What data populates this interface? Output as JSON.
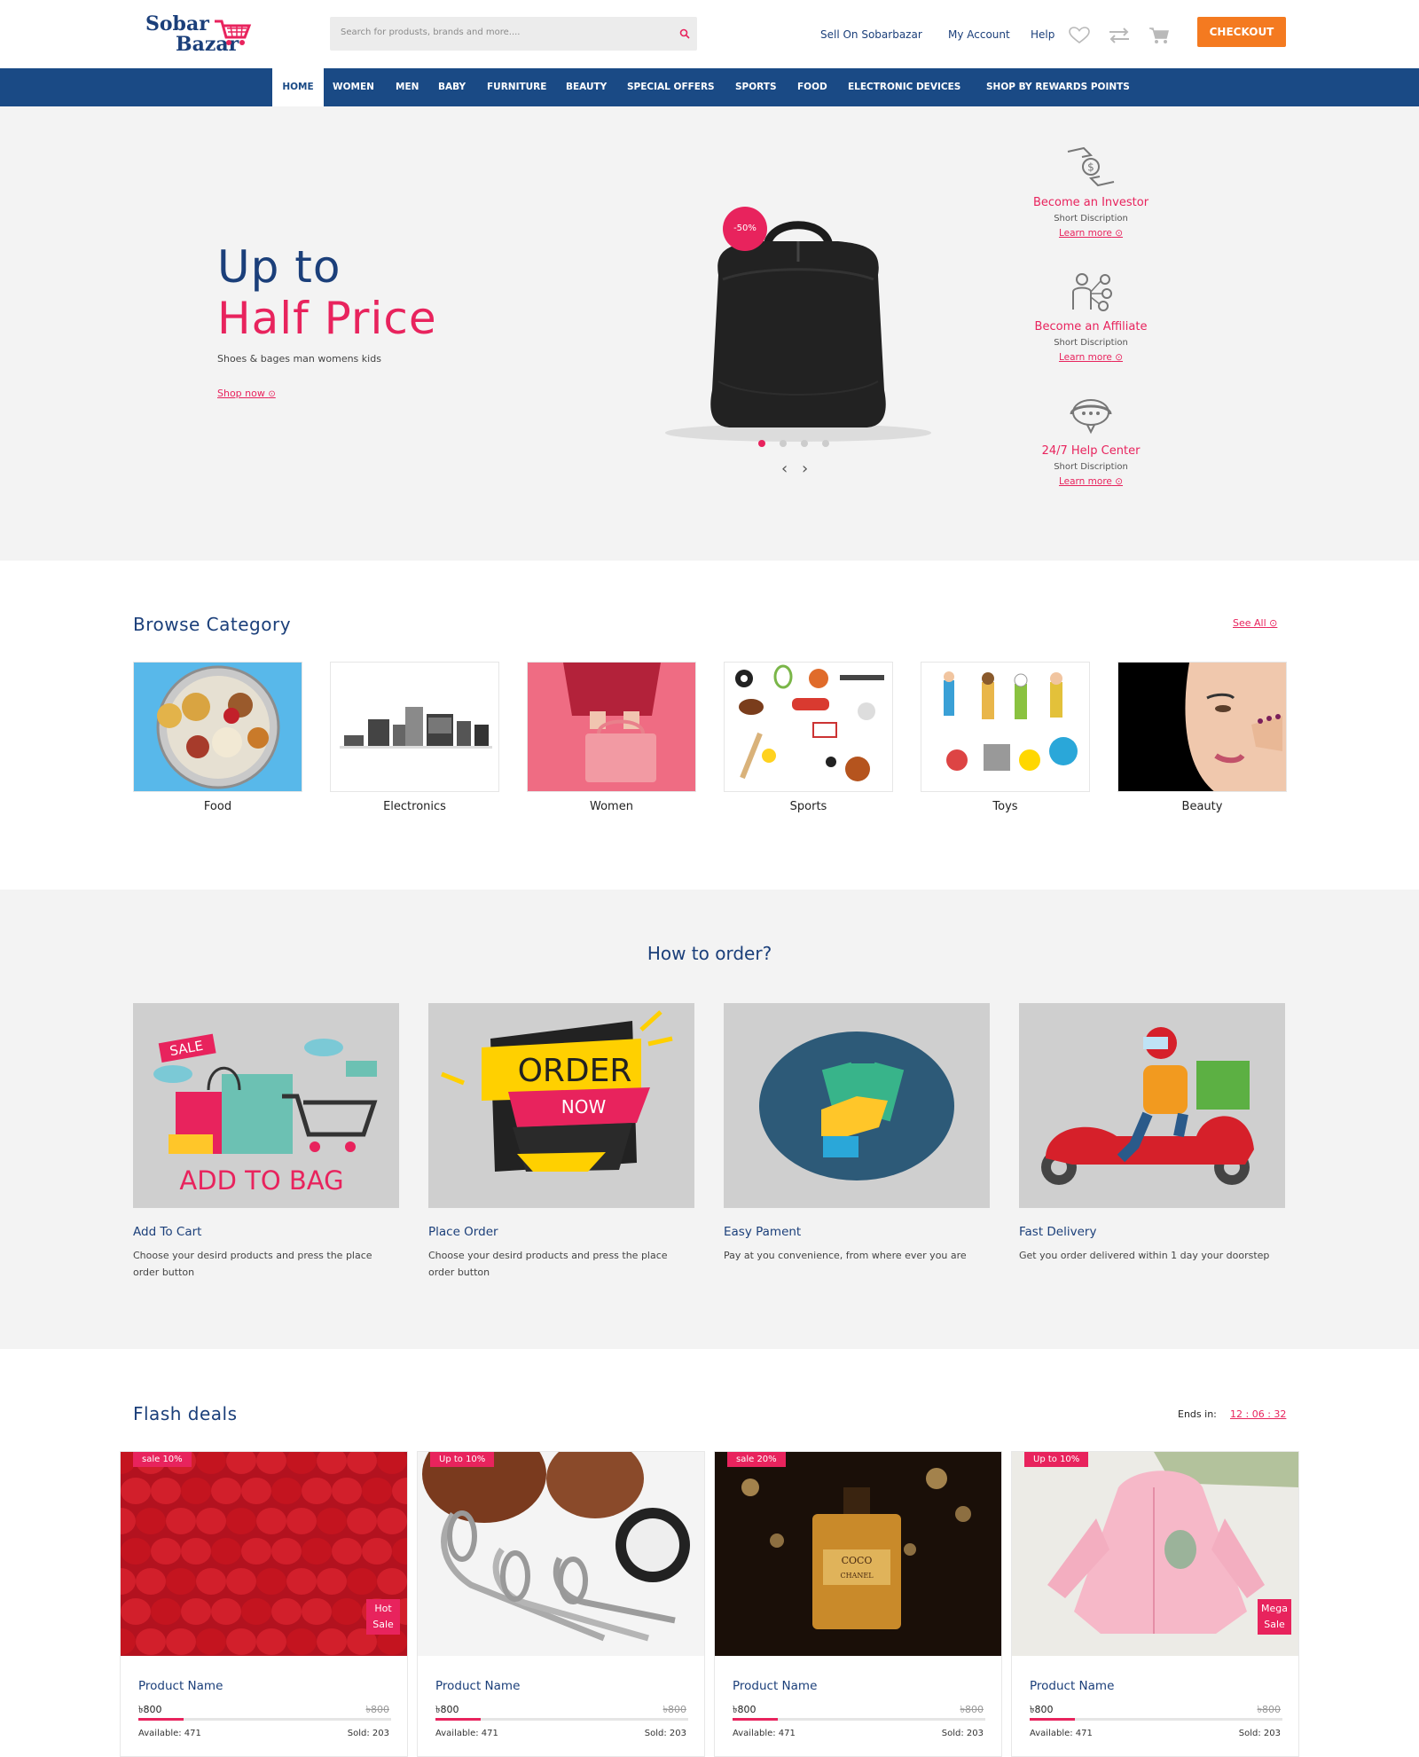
{
  "header": {
    "logo_line1": "Sobar",
    "logo_line2": "Bazar",
    "search_placeholder": "Search for produsts, brands and more....",
    "links": [
      "Sell On Sobarbazar",
      "My Account",
      "Help"
    ],
    "checkout_label": "CHECKOUT",
    "icons": [
      "heart-icon",
      "compare-icon",
      "cart-icon",
      "search-icon"
    ]
  },
  "nav": {
    "items": [
      "HOME",
      "WOMEN",
      "MEN",
      "BABY",
      "FURNITURE",
      "BEAUTY",
      "SPECIAL OFFERS",
      "SPORTS",
      "FOOD",
      "ELECTRONIC DEVICES",
      "SHOP BY REWARDS POINTS"
    ],
    "active": "HOME"
  },
  "hero": {
    "title_line1": "Up to",
    "title_line2": "Half Price",
    "subtitle": "Shoes & bages man womens kids",
    "cta": "Shop now",
    "badge": "-50%",
    "slide_count": 4,
    "active_slide": 1,
    "features": [
      {
        "title": "Become an Investor",
        "desc": "Short Discription",
        "link": "Learn more",
        "icon": "investor-icon"
      },
      {
        "title": "Become an Affiliate",
        "desc": "Short Discription",
        "link": "Learn more",
        "icon": "affiliate-icon"
      },
      {
        "title": "24/7 Help Center",
        "desc": "Short Discription",
        "link": "Learn more",
        "icon": "support-icon"
      }
    ]
  },
  "browse": {
    "title": "Browse Category",
    "see_all": "See All",
    "categories": [
      "Food",
      "Electronics",
      "Women",
      "Sports",
      "Toys",
      "Beauty"
    ]
  },
  "how": {
    "title": "How to order?",
    "steps": [
      {
        "title": "Add To Cart",
        "desc": "Choose your desird products and press the place order button",
        "image_text": "ADD TO BAG",
        "image_badge": "SALE"
      },
      {
        "title": "Place Order",
        "desc": "Choose your desird products and press the place order button",
        "image_text": "ORDER",
        "image_sub": "NOW"
      },
      {
        "title": "Easy Pament",
        "desc": "Pay at you convenience, from where ever you are"
      },
      {
        "title": "Fast Delivery",
        "desc": "Get you order delivered within 1 day your doorstep"
      }
    ]
  },
  "flash": {
    "title": "Flash deals",
    "ends_label": "Ends in:",
    "timer": "12 : 06 : 32",
    "products": [
      {
        "tag": "sale 10%",
        "badge": [
          "Hot",
          "Sale"
        ],
        "name": "Product Name",
        "price": "৳800",
        "old_price": "৳800",
        "available": "Available: 471",
        "sold": "Sold: 203",
        "sold_fraction": 0.18,
        "image": "strawberries"
      },
      {
        "tag": "Up to 10%",
        "badge": [],
        "name": "Product Name",
        "price": "৳800",
        "old_price": "৳800",
        "available": "Available: 471",
        "sold": "Sold: 203",
        "sold_fraction": 0.18,
        "image": "sim-ejector-pins"
      },
      {
        "tag": "sale 20%",
        "badge": [],
        "name": "Product Name",
        "price": "৳800",
        "old_price": "৳800",
        "available": "Available: 471",
        "sold": "Sold: 203",
        "sold_fraction": 0.18,
        "image": "perfume",
        "image_text": [
          "COCO",
          "CHANEL"
        ]
      },
      {
        "tag": "Up to 10%",
        "badge": [
          "Mega",
          "Sale"
        ],
        "name": "Product Name",
        "price": "৳800",
        "old_price": "৳800",
        "available": "Available: 471",
        "sold": "Sold: 203",
        "sold_fraction": 0.18,
        "image": "pink-baby-jacket"
      }
    ]
  },
  "colors": {
    "brand_blue": "#1a4a85",
    "accent_pink": "#e8235d",
    "checkout_orange": "#f47a20"
  }
}
